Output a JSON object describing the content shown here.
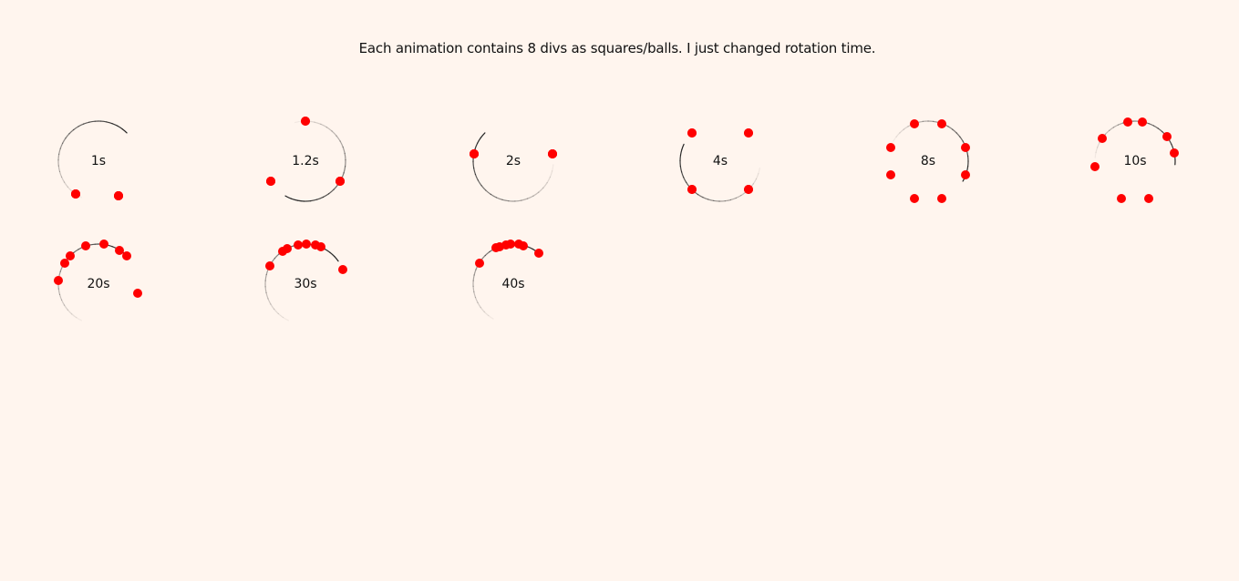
{
  "intro": "Each animation contains 8 divs as squares/balls. I just changed rotation time.",
  "colors": {
    "background": "#fff5ee",
    "ball": "#ff0000",
    "ring": "#222222"
  },
  "spinners": [
    {
      "label": "1s"
    },
    {
      "label": "1.2s"
    },
    {
      "label": "2s"
    },
    {
      "label": "4s"
    },
    {
      "label": "8s"
    },
    {
      "label": "10s"
    },
    {
      "label": "20s"
    },
    {
      "label": "30s"
    },
    {
      "label": "40s"
    }
  ]
}
